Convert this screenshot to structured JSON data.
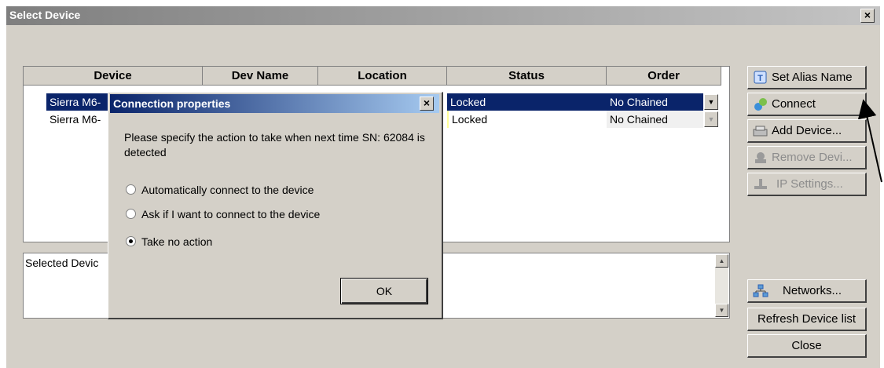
{
  "window": {
    "title": "Select Device",
    "close_label": "×"
  },
  "grid": {
    "columns": [
      "Device",
      "Dev Name",
      "Location",
      "Status",
      "Order"
    ],
    "rows": [
      {
        "device": "Sierra M6-",
        "status": "Locked",
        "order": "No Chained",
        "selected": true
      },
      {
        "device": "Sierra M6-",
        "status": "Locked",
        "order": "No Chained",
        "selected": false
      }
    ]
  },
  "bottom_panel": {
    "label": "Selected Devic"
  },
  "buttons": {
    "set_alias": "Set Alias Name",
    "connect": "Connect",
    "add_device": "Add Device...",
    "remove_device": "Remove Devi...",
    "ip_settings": "IP Settings...",
    "networks": "Networks...",
    "refresh": "Refresh Device list",
    "close": "Close"
  },
  "dialog": {
    "title": "Connection properties",
    "close_label": "×",
    "message": "Please specify the action to take when next time  SN: 62084 is detected",
    "options": [
      {
        "label": "Automatically connect to the device",
        "checked": false
      },
      {
        "label": "Ask if I want to connect to the device",
        "checked": false
      },
      {
        "label": "Take no action",
        "checked": true
      }
    ],
    "ok_label": "OK"
  },
  "colors": {
    "selection": "#0a246a",
    "dialog_title": "#0a246a",
    "window_bg": "#d4d0c8"
  }
}
